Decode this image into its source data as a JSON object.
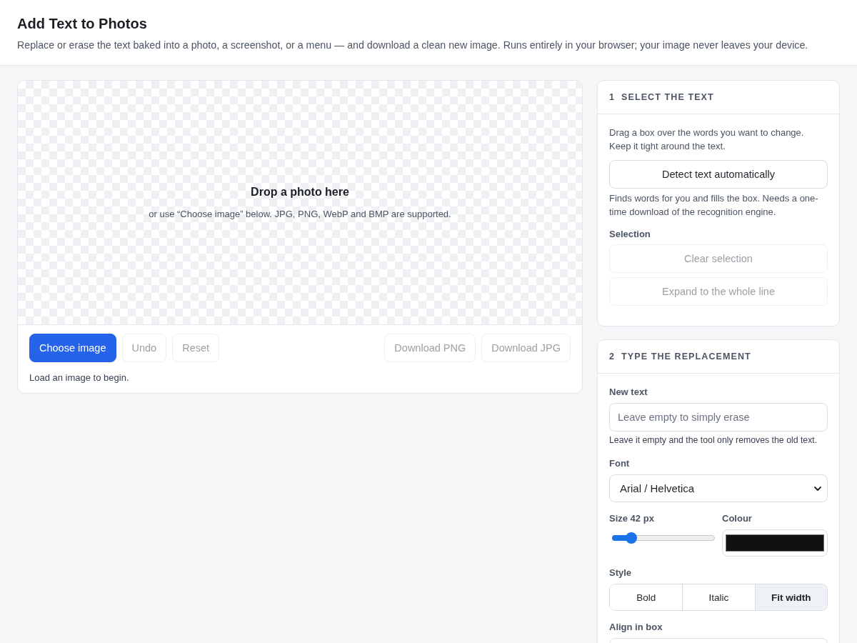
{
  "header": {
    "title": "Add Text to Photos",
    "subtitle": "Replace or erase the text baked into a photo, a screenshot, or a menu — and download a clean new image. Runs entirely in your browser; your image never leaves your device."
  },
  "canvas": {
    "drop_title": "Drop a photo here",
    "drop_hint": "or use “Choose image” below. JPG, PNG, WebP and BMP are supported."
  },
  "toolbar": {
    "left_buttons": [
      {
        "label": "Choose image",
        "kind": "primary",
        "disabled": false
      },
      {
        "label": "Undo",
        "kind": "plain",
        "disabled": true
      },
      {
        "label": "Reset",
        "kind": "plain",
        "disabled": true
      }
    ],
    "right_buttons": [
      {
        "label": "Download PNG",
        "kind": "plain",
        "disabled": true
      },
      {
        "label": "Download JPG",
        "kind": "plain",
        "disabled": true
      }
    ],
    "status": "Load an image to begin."
  },
  "select_panel": {
    "number": "1",
    "title": "SELECT THE TEXT",
    "instructions": "Drag a box over the words you want to change. Keep it tight around the text.",
    "detect_button": {
      "label": "Detect text automatically",
      "disabled": false
    },
    "detect_hint": "Finds words for you and fills the box. Needs a one-time download of the recognition engine.",
    "selection_label": "Selection",
    "selection_buttons": [
      {
        "label": "Clear selection",
        "disabled": true
      },
      {
        "label": "Expand to the whole line",
        "disabled": true
      }
    ]
  },
  "replace_panel": {
    "number": "2",
    "title": "TYPE THE REPLACEMENT",
    "new_text": {
      "label": "New text",
      "placeholder": "Leave empty to simply erase",
      "hint": "Leave it empty and the tool only removes the old text."
    },
    "font": {
      "label": "Font",
      "value": "Arial / Helvetica"
    },
    "size": {
      "label": "Size 42 px",
      "level": 0.18
    },
    "colour": {
      "label": "Colour",
      "color": "#111111"
    },
    "style": {
      "label": "Style",
      "options": [
        {
          "label": "Bold",
          "selected": false
        },
        {
          "label": "Italic",
          "selected": false
        },
        {
          "label": "Fit width",
          "selected": true
        }
      ]
    },
    "align": {
      "label": "Align in box"
    }
  }
}
